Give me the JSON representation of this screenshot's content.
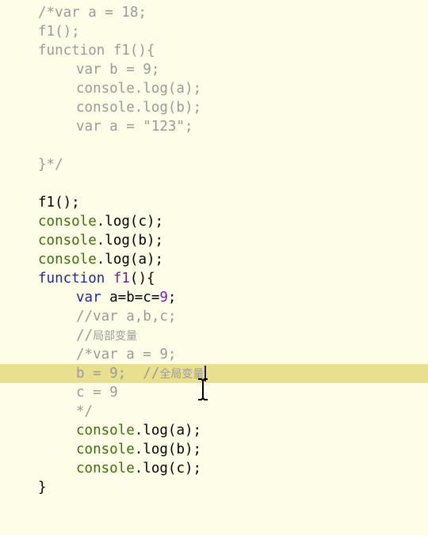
{
  "editor": {
    "lines": [
      {
        "segments": [
          {
            "text": "/*var a = 18;"
          }
        ]
      },
      {
        "segments": [
          {
            "text": "f1();"
          }
        ]
      },
      {
        "segments": [
          {
            "text": "function f1(){"
          }
        ]
      },
      {
        "segments": [
          {
            "text": "var b = 9;"
          }
        ]
      },
      {
        "segments": [
          {
            "text": "console.log(a);"
          }
        ]
      },
      {
        "segments": [
          {
            "text": "console.log(b);"
          }
        ]
      },
      {
        "segments": [
          {
            "text": "var a = \"123\";"
          }
        ]
      },
      {
        "segments": []
      },
      {
        "segments": [
          {
            "text": "}*/"
          }
        ]
      },
      {
        "segments": []
      },
      {
        "segments": [
          {
            "text": "f1();"
          }
        ]
      },
      {
        "segments": [
          {
            "text": "console"
          },
          {
            "text": ".log(c);"
          }
        ]
      },
      {
        "segments": [
          {
            "text": "console"
          },
          {
            "text": ".log(b);"
          }
        ]
      },
      {
        "segments": [
          {
            "text": "console"
          },
          {
            "text": ".log(a);"
          }
        ]
      },
      {
        "segments": [
          {
            "text": "function"
          },
          {
            "text": " "
          },
          {
            "text": "f1"
          },
          {
            "text": "(){"
          }
        ]
      },
      {
        "segments": [
          {
            "text": "var"
          },
          {
            "text": " a=b=c="
          },
          {
            "text": "9"
          },
          {
            "text": ";"
          }
        ]
      },
      {
        "segments": [
          {
            "text": "//var a,b,c;"
          }
        ]
      },
      {
        "segments": [
          {
            "text": "//"
          },
          {
            "text": "局部变量"
          }
        ]
      },
      {
        "segments": [
          {
            "text": "/*var a = 9;"
          }
        ]
      },
      {
        "segments": [
          {
            "text": "b = 9;  //"
          },
          {
            "text": "全局变量"
          }
        ]
      },
      {
        "segments": [
          {
            "text": "c = 9"
          }
        ]
      },
      {
        "segments": [
          {
            "text": "*/"
          }
        ]
      },
      {
        "segments": [
          {
            "text": "console"
          },
          {
            "text": ".log(a);"
          }
        ]
      },
      {
        "segments": [
          {
            "text": "console"
          },
          {
            "text": ".log(b);"
          }
        ]
      },
      {
        "segments": [
          {
            "text": "console"
          },
          {
            "text": ".log(c);"
          }
        ]
      },
      {
        "segments": [
          {
            "text": "}"
          }
        ]
      }
    ],
    "current_line": 20
  },
  "colors": {
    "background": "#fdfde8",
    "current_line_highlight": "#e8e08e",
    "comment": "#9a9a9a",
    "keyword": "#1f26a6",
    "function_name": "#7f1f8c",
    "number": "#8a10c8",
    "object": "#3a6f0c",
    "plain": "#000000"
  },
  "cursor": {
    "type": "i-beam-icon"
  }
}
